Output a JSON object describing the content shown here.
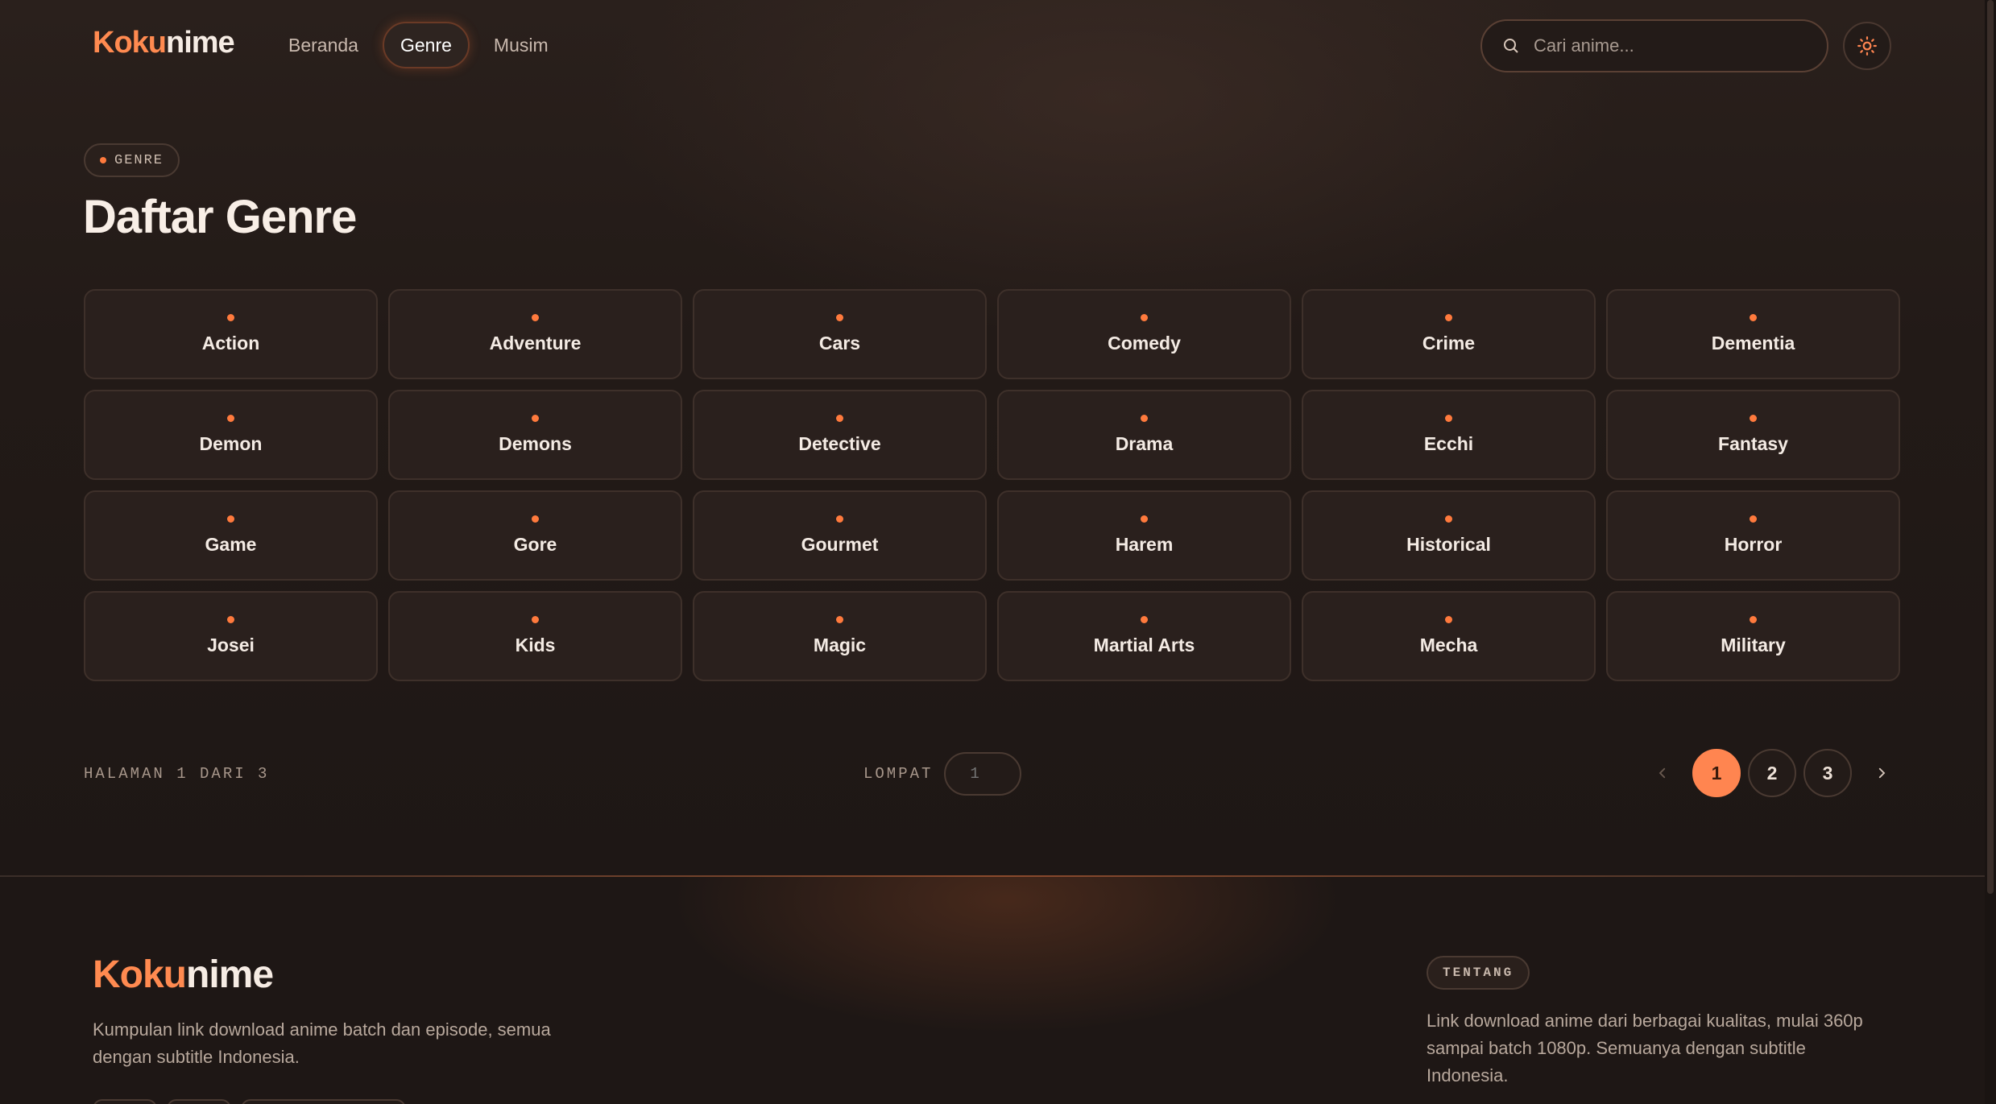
{
  "header": {
    "logo_part1": "Koku",
    "logo_part2": "nime",
    "nav": [
      {
        "label": "Beranda",
        "active": false
      },
      {
        "label": "Genre",
        "active": true
      },
      {
        "label": "Musim",
        "active": false
      }
    ],
    "search_placeholder": "Cari anime...",
    "theme_icon": "sun-icon"
  },
  "main": {
    "badge": "GENRE",
    "title": "Daftar Genre",
    "genres": [
      "Action",
      "Adventure",
      "Cars",
      "Comedy",
      "Crime",
      "Dementia",
      "Demon",
      "Demons",
      "Detective",
      "Drama",
      "Ecchi",
      "Fantasy",
      "Game",
      "Gore",
      "Gourmet",
      "Harem",
      "Historical",
      "Horror",
      "Josei",
      "Kids",
      "Magic",
      "Martial Arts",
      "Mecha",
      "Military"
    ]
  },
  "pagination": {
    "info": "HALAMAN 1 DARI 3",
    "jump_label": "LOMPAT",
    "jump_placeholder": "1",
    "pages": [
      "1",
      "2",
      "3"
    ],
    "current": "1"
  },
  "footer": {
    "logo_part1": "Koku",
    "logo_part2": "nime",
    "description": "Kumpulan link download anime batch dan episode, semua dengan subtitle Indonesia.",
    "about_badge": "TENTANG",
    "about_text": "Link download anime dari berbagai kualitas, mulai 360p sampai batch 1080p. Semuanya dengan subtitle Indonesia."
  },
  "colors": {
    "accent": "#ff8550",
    "background": "#1e1715",
    "card": "#2a201d"
  }
}
